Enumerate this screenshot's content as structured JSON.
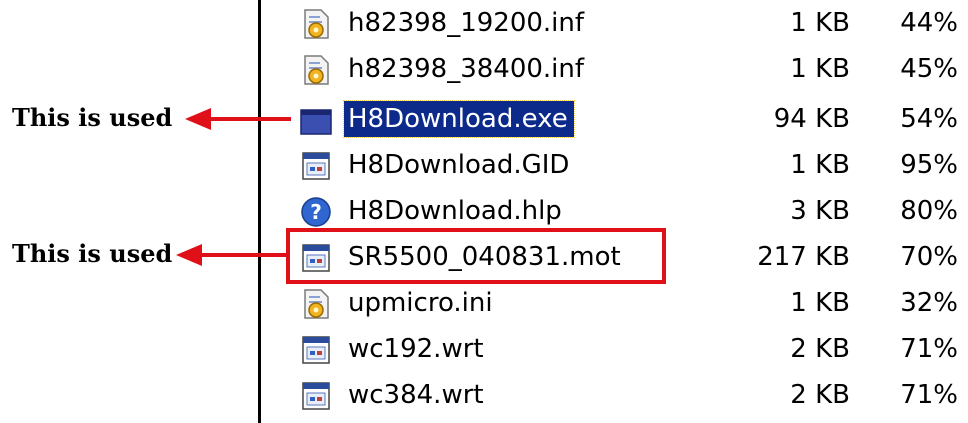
{
  "annotations": [
    {
      "text": "This is used",
      "target": "H8Download.exe"
    },
    {
      "text": "This is used",
      "target": "SR5500_040831.mot"
    }
  ],
  "colors": {
    "selection": "#0b2a8a",
    "annotation_arrow": "#e01018"
  },
  "files": [
    {
      "name": "h82398_19200.inf",
      "size": "1 KB",
      "ratio": "44%",
      "icon": "ini-settings-icon",
      "selected": false
    },
    {
      "name": "h82398_38400.inf",
      "size": "1 KB",
      "ratio": "45%",
      "icon": "ini-settings-icon",
      "selected": false
    },
    {
      "name": "H8Download.exe",
      "size": "94 KB",
      "ratio": "54%",
      "icon": "exe-window-icon",
      "selected": true
    },
    {
      "name": "H8Download.GID",
      "size": "1 KB",
      "ratio": "95%",
      "icon": "generic-file-icon",
      "selected": false
    },
    {
      "name": "H8Download.hlp",
      "size": "3 KB",
      "ratio": "80%",
      "icon": "help-icon",
      "selected": false
    },
    {
      "name": "SR5500_040831.mot",
      "size": "217 KB",
      "ratio": "70%",
      "icon": "generic-file-icon",
      "selected": false,
      "boxed": true
    },
    {
      "name": "upmicro.ini",
      "size": "1 KB",
      "ratio": "32%",
      "icon": "ini-settings-icon",
      "selected": false
    },
    {
      "name": "wc192.wrt",
      "size": "2 KB",
      "ratio": "71%",
      "icon": "generic-file-icon",
      "selected": false
    },
    {
      "name": "wc384.wrt",
      "size": "2 KB",
      "ratio": "71%",
      "icon": "generic-file-icon",
      "selected": false
    }
  ]
}
